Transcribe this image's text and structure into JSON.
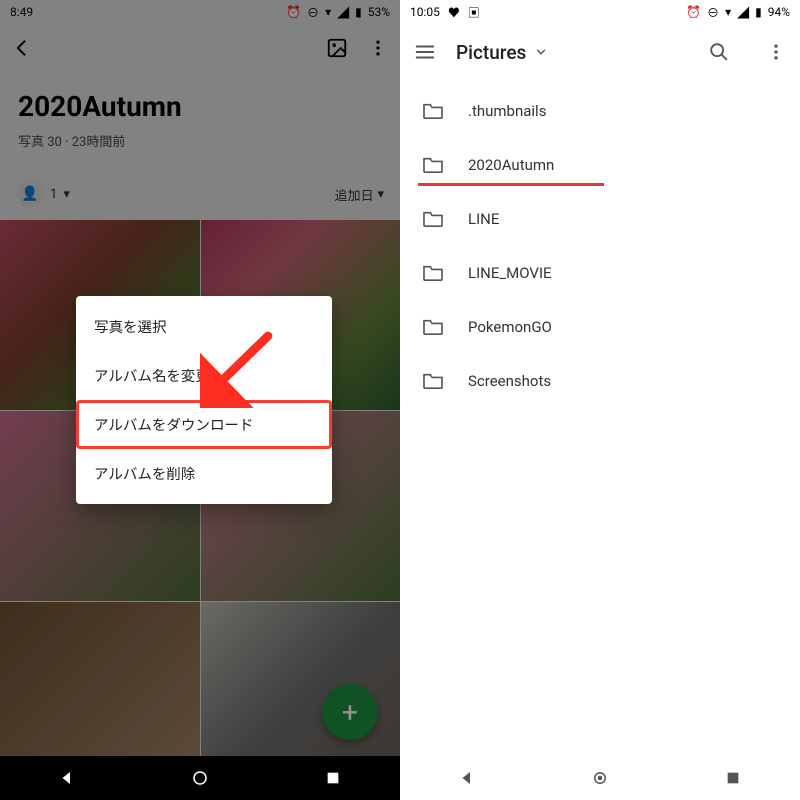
{
  "left": {
    "status": {
      "time": "8:49",
      "battery_pct": "53%"
    },
    "album": {
      "title": "2020Autumn",
      "photo_count_label": "写真 30",
      "age_label": "23時間前",
      "member_count": "1",
      "sort_label": "追加日"
    },
    "menu": {
      "items": [
        {
          "label": "写真を選択"
        },
        {
          "label": "アルバム名を変更"
        },
        {
          "label": "アルバムをダウンロード"
        },
        {
          "label": "アルバムを削除"
        }
      ],
      "highlight_index": 2
    },
    "fab_label": "+"
  },
  "right": {
    "status": {
      "time": "10:05",
      "battery_pct": "94%"
    },
    "toolbar": {
      "title": "Pictures"
    },
    "folders": [
      {
        "name": ".thumbnails"
      },
      {
        "name": "2020Autumn",
        "highlight": true
      },
      {
        "name": "LINE"
      },
      {
        "name": "LINE_MOVIE"
      },
      {
        "name": "PokemonGO"
      },
      {
        "name": "Screenshots"
      }
    ]
  }
}
